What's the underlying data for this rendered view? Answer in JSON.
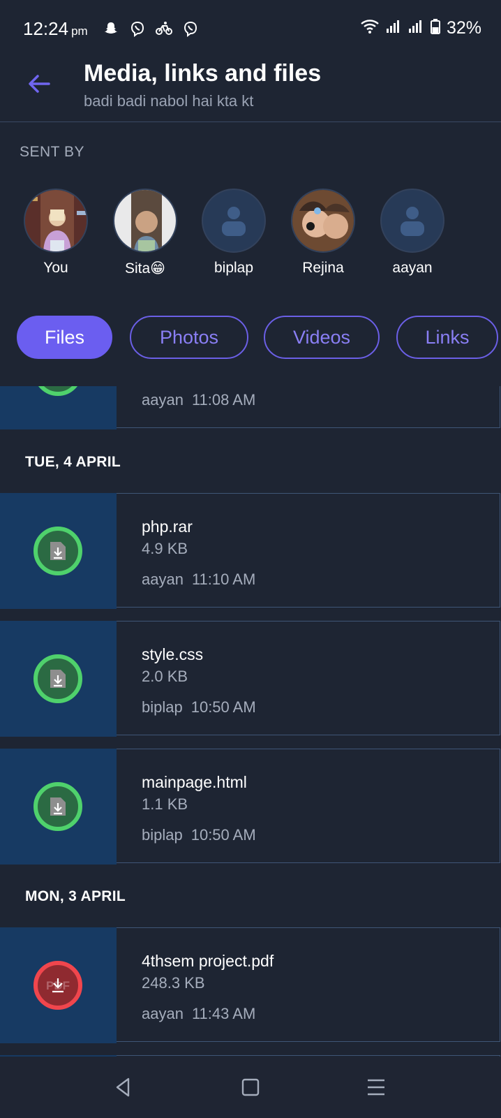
{
  "status_bar": {
    "time": "12:24",
    "ampm": "pm",
    "battery": "32%",
    "icons": [
      "snapchat-icon",
      "viber-icon",
      "bicycle-icon",
      "viber-icon",
      "wifi-icon",
      "signal-icon",
      "signal-icon",
      "battery-icon"
    ]
  },
  "header": {
    "title": "Media, links and files",
    "subtitle": "badi badi nabol hai kta kt",
    "back_icon": "arrow-left-icon"
  },
  "sent_by": {
    "label": "SENT BY",
    "senders": [
      {
        "name": "You",
        "avatar": "photo"
      },
      {
        "name": "Sita😁",
        "avatar": "photo"
      },
      {
        "name": "biplap",
        "avatar": "placeholder"
      },
      {
        "name": "Rejina",
        "avatar": "photo"
      },
      {
        "name": "aayan",
        "avatar": "placeholder"
      }
    ]
  },
  "tabs": [
    {
      "label": "Files",
      "active": true
    },
    {
      "label": "Photos",
      "active": false
    },
    {
      "label": "Videos",
      "active": false
    },
    {
      "label": "Links",
      "active": false
    }
  ],
  "files": {
    "partial_top": {
      "sender": "aayan",
      "time": "11:08 AM"
    },
    "groups": [
      {
        "date": "TUE, 4 APRIL",
        "items": [
          {
            "name": "php.rar",
            "size": "4.9 KB",
            "sender": "aayan",
            "time": "11:10 AM",
            "type": "generic"
          },
          {
            "name": "style.css",
            "size": "2.0 KB",
            "sender": "biplap",
            "time": "10:50 AM",
            "type": "generic"
          },
          {
            "name": "mainpage.html",
            "size": "1.1 KB",
            "sender": "biplap",
            "time": "10:50 AM",
            "type": "generic"
          }
        ]
      },
      {
        "date": "MON, 3 APRIL",
        "items": [
          {
            "name": "4thsem project.pdf",
            "size": "248.3 KB",
            "sender": "aayan",
            "time": "11:43 AM",
            "type": "pdf"
          }
        ]
      }
    ]
  },
  "colors": {
    "background": "#1e2533",
    "accent": "#6b5ef0",
    "thumb": "#173a63",
    "download_green": "#4fd16c",
    "download_red": "#f0464d"
  }
}
